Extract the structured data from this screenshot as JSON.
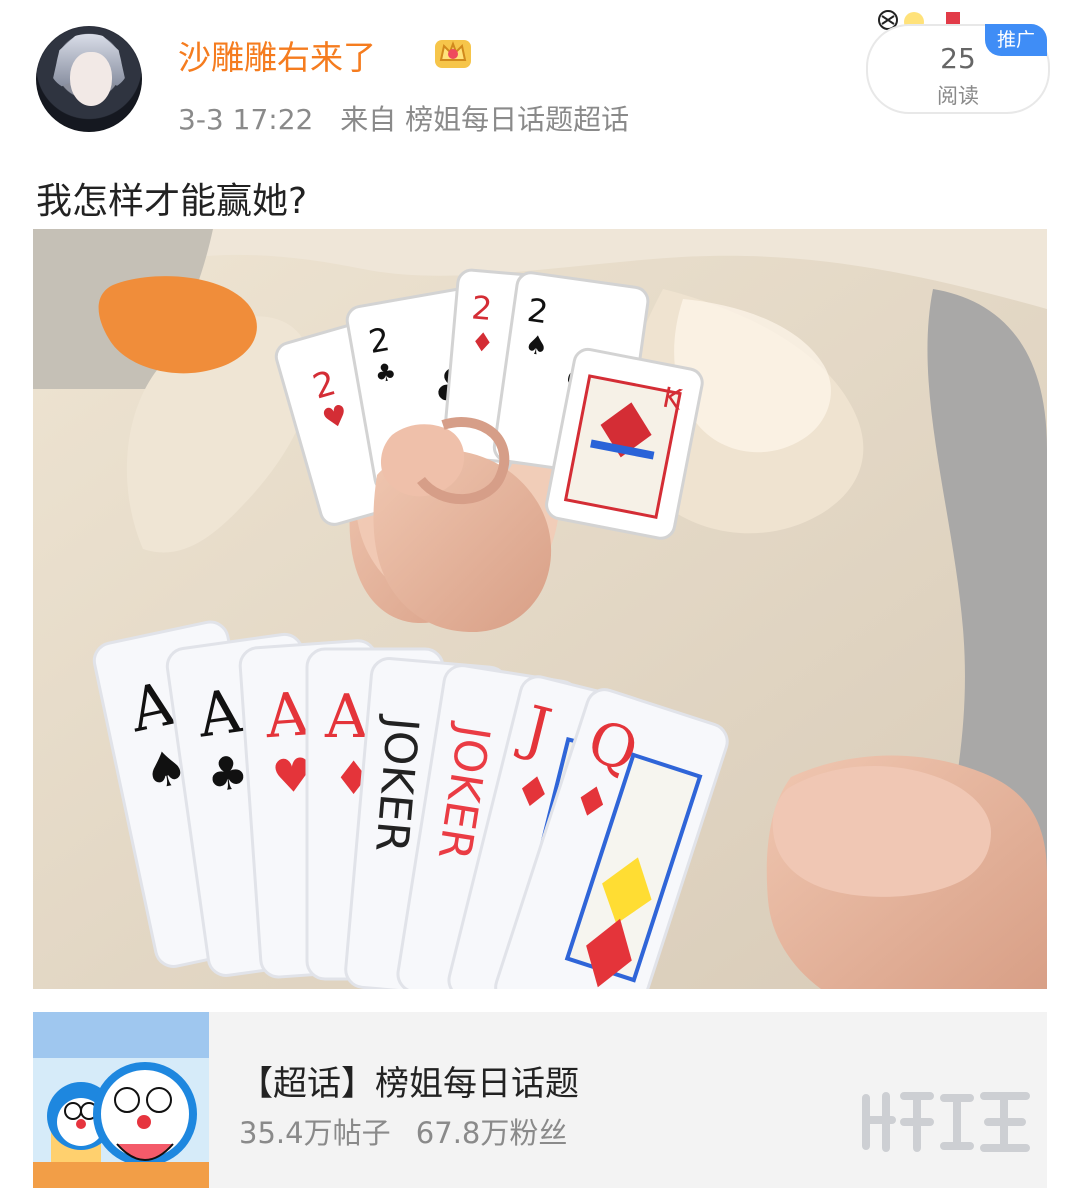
{
  "post": {
    "author": {
      "name": "沙雕雕右来了",
      "avatar_icon": "anime-avatar-icon",
      "badge_icon": "crown-badge-icon"
    },
    "meta": {
      "time": "3-3 17:22",
      "source": "来自 榜姐每日话题超话"
    },
    "read_info": {
      "count": "25",
      "label": "阅读",
      "tag": "推广"
    },
    "text": "我怎样才能赢她?",
    "image": {
      "subject": "poker-cards-photo",
      "back_hand": [
        "2",
        "2",
        "2",
        "2",
        "K"
      ],
      "front_hand": [
        "A",
        "A",
        "A",
        "A",
        "JOKER",
        "JOKER",
        "J",
        "Q"
      ]
    }
  },
  "topic_card": {
    "title": "【超话】榜姐每日话题",
    "posts": "35.4万帖子",
    "fans": "67.8万粉丝"
  },
  "watermark_icon": "watermark-logo-icon"
}
